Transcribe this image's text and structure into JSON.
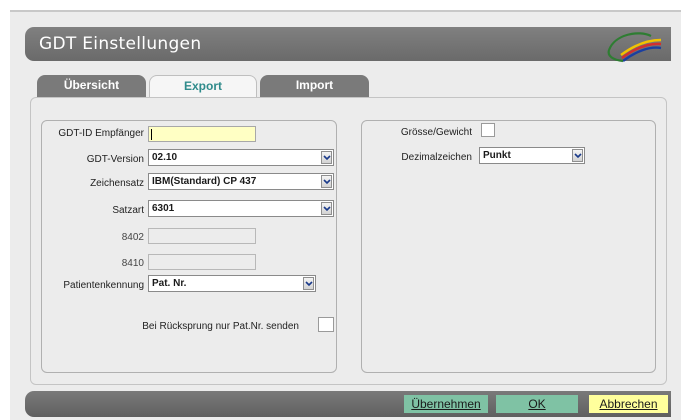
{
  "window": {
    "title": "GDT Einstellungen"
  },
  "tabs": [
    {
      "label": "Übersicht",
      "active": false
    },
    {
      "label": "Export",
      "active": true
    },
    {
      "label": "Import",
      "active": false
    }
  ],
  "left": {
    "gdt_id_empfaenger": {
      "label": "GDT-ID Empfänger",
      "value": ""
    },
    "gdt_version": {
      "label": "GDT-Version",
      "value": "02.10"
    },
    "zeichensatz": {
      "label": "Zeichensatz",
      "value": "IBM(Standard) CP 437"
    },
    "satzart": {
      "label": "Satzart",
      "value": "6301"
    },
    "field_8402": {
      "label": "8402",
      "value": ""
    },
    "field_8410": {
      "label": "8410",
      "value": ""
    },
    "patientenkennung": {
      "label": "Patientenkennung",
      "value": "Pat. Nr."
    },
    "rueckspr": {
      "label": "Bei Rücksprung nur Pat.Nr. senden",
      "checked": false
    }
  },
  "right": {
    "groesse_gewicht": {
      "label": "Grösse/Gewicht",
      "checked": false
    },
    "dezimalzeichen": {
      "label": "Dezimalzeichen",
      "value": "Punkt"
    }
  },
  "buttons": {
    "uebernehmen": "Übernehmen",
    "ok": "OK",
    "abbrechen": "Abbrechen"
  },
  "colors": {
    "titlebar": "#737373",
    "active_tab_text": "#2f8b8b",
    "id_field_bg": "#ffffc4",
    "btn_green": "#7fc2a4",
    "btn_yellow": "#ffff9c"
  },
  "icons": {
    "logo": "swoosh-logo",
    "dropdown": "chevron-down-icon"
  }
}
